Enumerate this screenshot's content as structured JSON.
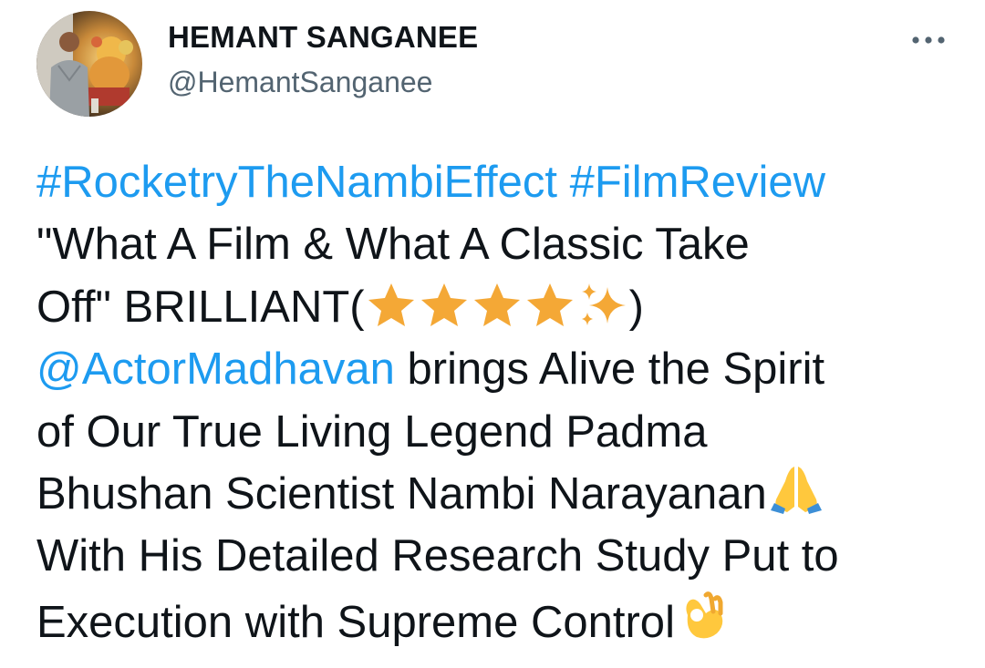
{
  "author": {
    "display_name": "HEMANT SANGANEE",
    "handle": "@HemantSanganee"
  },
  "menu": {
    "icon": "more-horizontal-icon"
  },
  "tweet": {
    "hashtag_1": "#RocketryTheNambiEffect",
    "hashtag_2": "#FilmReview",
    "line_2": "\"What A Film & What A Classic Take",
    "line_3_before": "Off\" BRILLIANT(",
    "line_3_after": ")",
    "rating_emojis": [
      "star",
      "star",
      "star",
      "star",
      "sparkles"
    ],
    "mention": "@ActorMadhavan",
    "line_4_rest": " brings Alive the Spirit",
    "line_5": "of Our True Living Legend Padma",
    "line_6": "Bhushan Scientist Nambi Narayanan",
    "line_6_emoji": "folded-hands",
    "line_7": "With His Detailed Research Study Put to",
    "line_8": "Execution with Supreme Control",
    "line_8_emoji": "ok-hand"
  },
  "colors": {
    "link": "#1d9bf0",
    "text": "#0f1419",
    "secondary": "#536471",
    "star": "#f4a836"
  }
}
